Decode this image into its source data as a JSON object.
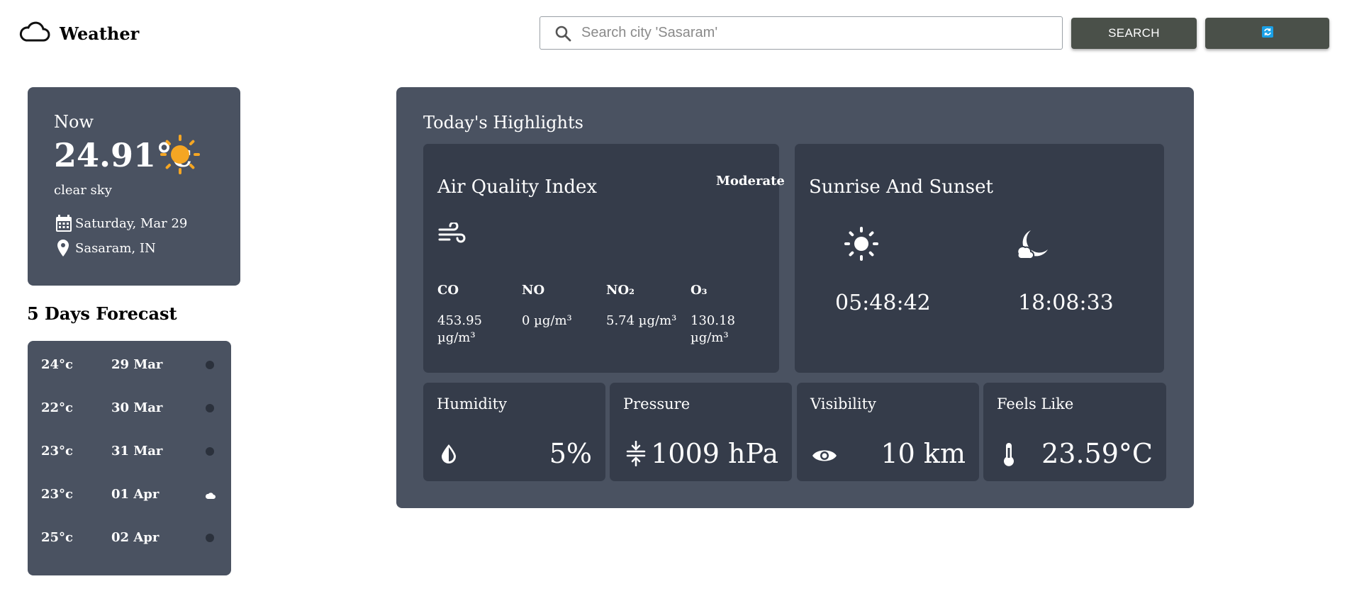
{
  "app": {
    "title": "Weather",
    "logo_icon": "cloud-icon"
  },
  "search": {
    "placeholder": "Search city 'Sasaram'",
    "value": "",
    "button_label": "SEARCH",
    "refresh_icon": "refresh-icon"
  },
  "current": {
    "label": "Now",
    "temperature": "24.91°c",
    "condition": "clear sky",
    "condition_icon": "sun-icon",
    "date": "Saturday, Mar 29",
    "location": "Sasaram, IN"
  },
  "forecast": {
    "title": "5 Days Forecast",
    "days": [
      {
        "temp": "24°c",
        "date": "29 Mar",
        "icon": "dot-icon"
      },
      {
        "temp": "22°c",
        "date": "30 Mar",
        "icon": "dot-icon"
      },
      {
        "temp": "23°c",
        "date": "31 Mar",
        "icon": "dot-icon"
      },
      {
        "temp": "23°c",
        "date": "01 Apr",
        "icon": "cloud-icon"
      },
      {
        "temp": "25°c",
        "date": "02 Apr",
        "icon": "dot-icon"
      }
    ]
  },
  "highlights": {
    "title": "Today's Highlights",
    "aqi": {
      "title": "Air Quality Index",
      "status": "Moderate",
      "icon": "wind-icon",
      "pollutants": [
        {
          "label": "CO",
          "value": "453.95 µg/m³"
        },
        {
          "label": "NO",
          "value": "0 µg/m³"
        },
        {
          "label": "NO₂",
          "value": "5.74 µg/m³"
        },
        {
          "label": "O₃",
          "value": "130.18 µg/m³"
        }
      ]
    },
    "sun": {
      "title": "Sunrise And Sunset",
      "sunrise": "05:48:42",
      "sunset": "18:08:33"
    },
    "stats": [
      {
        "label": "Humidity",
        "value": "5%",
        "icon": "droplet-icon"
      },
      {
        "label": "Pressure",
        "value": "1009 hPa",
        "icon": "pressure-icon"
      },
      {
        "label": "Visibility",
        "value": "10 km",
        "icon": "eye-icon"
      },
      {
        "label": "Feels Like",
        "value": "23.59°C",
        "icon": "thermometer-icon"
      }
    ]
  },
  "colors": {
    "card": "#4a5261",
    "panel": "#353c4a",
    "button": "#4a5049",
    "sun": "#f5a623"
  }
}
